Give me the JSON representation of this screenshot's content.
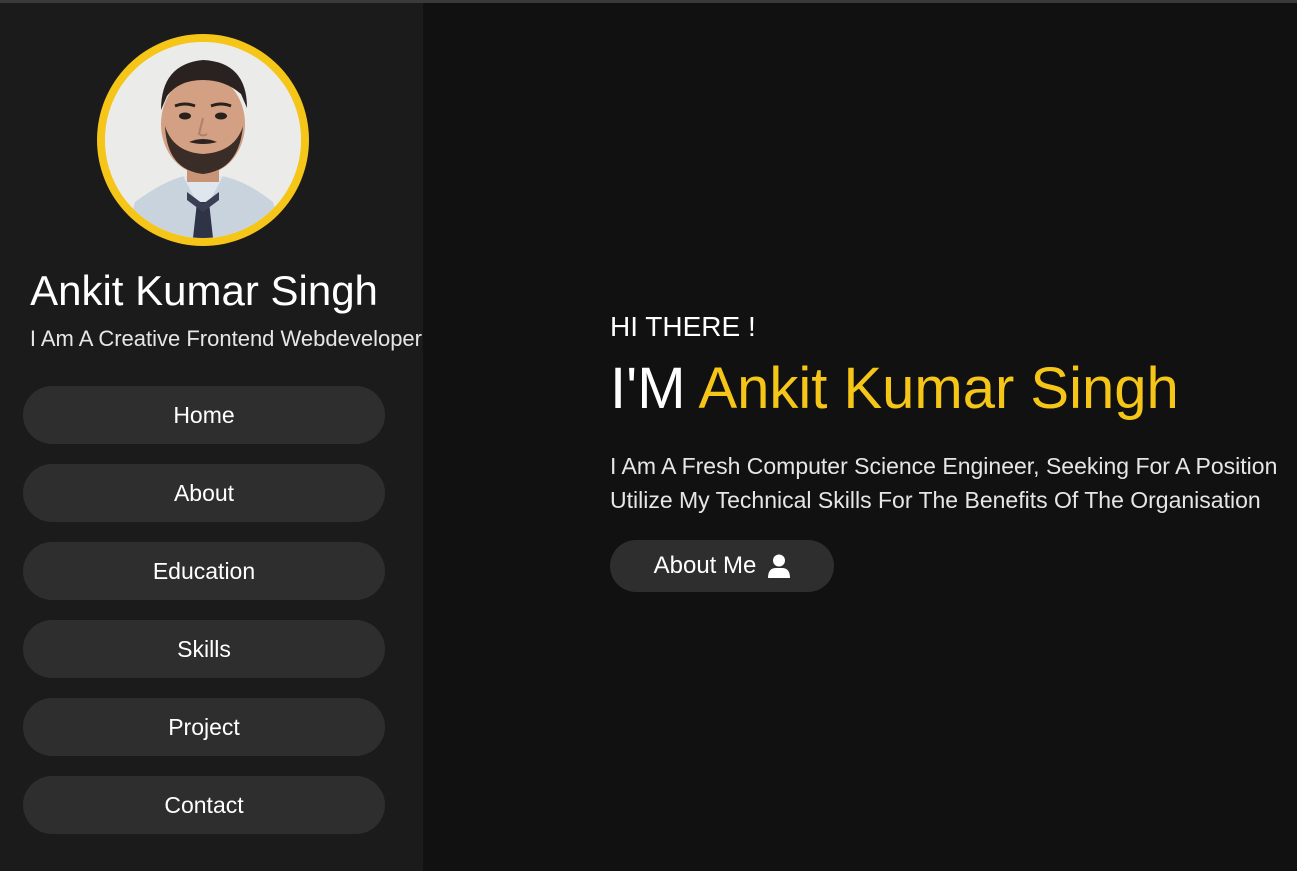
{
  "colors": {
    "accent": "#f5c518",
    "background": "#111111",
    "sidebar_background": "#1b1b1b",
    "button_background": "#2e2e2e",
    "text": "#ffffff"
  },
  "sidebar": {
    "name": "Ankit Kumar Singh",
    "role": "I Am A Creative Frontend Webdeveloper",
    "nav": [
      {
        "label": "Home"
      },
      {
        "label": "About"
      },
      {
        "label": "Education"
      },
      {
        "label": "Skills"
      },
      {
        "label": "Project"
      },
      {
        "label": "Contact"
      }
    ]
  },
  "hero": {
    "greeting": "HI THERE !",
    "intro": "I'M",
    "name": "Ankit Kumar Singh",
    "description_line1": "I Am A Fresh Computer Science Engineer, Seeking For A Position",
    "description_line2": "Utilize My Technical Skills For The Benefits Of The Organisation",
    "cta_label": "About Me",
    "cta_icon": "user-icon"
  }
}
